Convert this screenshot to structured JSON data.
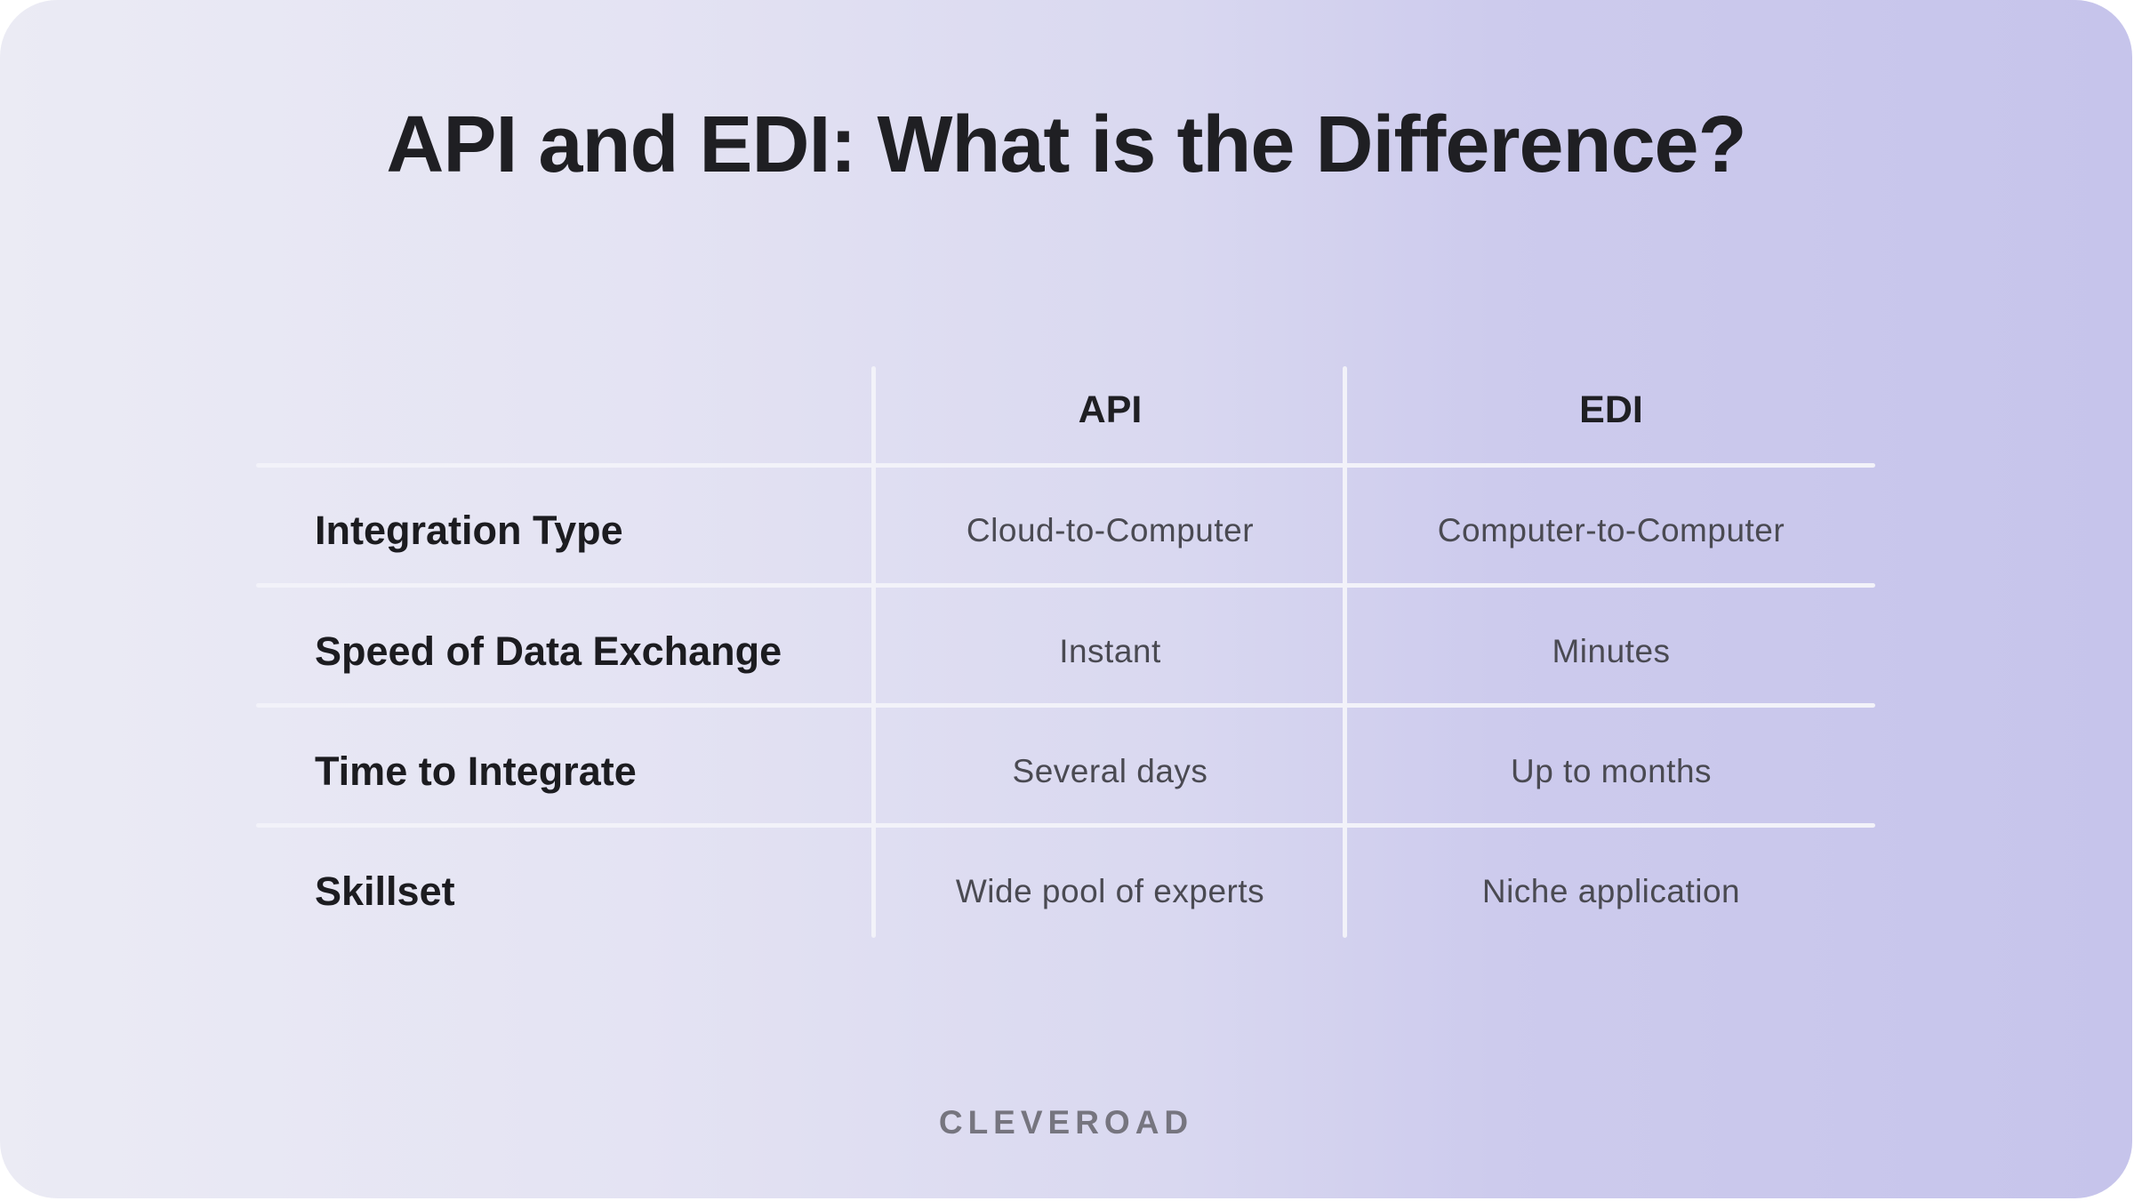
{
  "title": "API and EDI: What is the Difference?",
  "table": {
    "columns": [
      "API",
      "EDI"
    ],
    "rows": [
      {
        "label": "Integration Type",
        "api": "Cloud-to-Computer",
        "edi": "Computer-to-Computer"
      },
      {
        "label": "Speed of Data Exchange",
        "api": "Instant",
        "edi": "Minutes"
      },
      {
        "label": "Time to Integrate",
        "api": "Several days",
        "edi": "Up to months"
      },
      {
        "label": "Skillset",
        "api": "Wide pool of experts",
        "edi": "Niche application"
      }
    ]
  },
  "brand": "CLEVEROAD",
  "colors": {
    "background_left": "#ebebf4",
    "background_right": "#c6c4eb",
    "heading_text": "#1f1f23",
    "value_text": "#4a4a52",
    "grid_lines": "#f2f2f9",
    "brand_text": "#76757f"
  }
}
